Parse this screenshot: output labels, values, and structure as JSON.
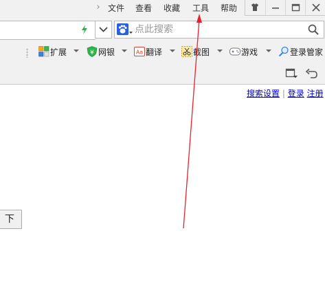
{
  "menu": {
    "items": [
      "文件",
      "查看",
      "收藏",
      "工具",
      "帮助"
    ]
  },
  "window_controls": [
    "skin-icon",
    "minimize-icon",
    "restore-icon",
    "close-icon"
  ],
  "search": {
    "placeholder": "点此搜索",
    "engine": "baidu-paw-icon"
  },
  "toolbar": {
    "extensions": "扩展",
    "banking": "网银",
    "translate": "翻译",
    "screenshot": "截图",
    "games": "游戏",
    "login_manager": "登录管家"
  },
  "page": {
    "search_settings": "搜索设置",
    "separator": "|",
    "login": "登录",
    "register": "注册",
    "button_label": "下"
  },
  "colors": {
    "chrome_bg": "#f1f1f1",
    "link": "#0000cc",
    "annotation_arrow": "#e8212a",
    "lightning": "#2fb34a"
  }
}
